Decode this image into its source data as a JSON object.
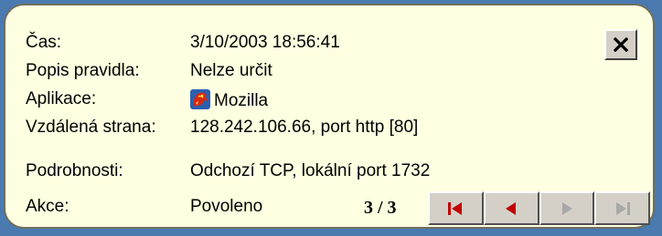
{
  "labels": {
    "time": "Čas:",
    "rule": "Popis pravidla:",
    "application": "Aplikace:",
    "remote": "Vzdálená strana:",
    "details": "Podrobnosti:",
    "action": "Akce:"
  },
  "values": {
    "time": "3/10/2003 18:56:41",
    "rule": "Nelze určit",
    "application": "Mozilla",
    "remote": "128.242.106.66, port http [80]",
    "details": "Odchozí TCP, lokální port 1732",
    "action": "Povoleno"
  },
  "navigation": {
    "counter": "3 / 3",
    "buttons": [
      {
        "icon": "first-icon",
        "enabled": true
      },
      {
        "icon": "previous-icon",
        "enabled": true
      },
      {
        "icon": "next-icon",
        "enabled": false
      },
      {
        "icon": "last-icon",
        "enabled": false
      }
    ]
  },
  "icons": {
    "close": "close-icon",
    "application": "mozilla-icon"
  },
  "colors": {
    "panel_background": "#ffffe1",
    "button_face": "#d4d0c8",
    "nav_active": "#c00000",
    "nav_disabled": "#a8a8a8",
    "desktop": "#4a7ab0"
  }
}
